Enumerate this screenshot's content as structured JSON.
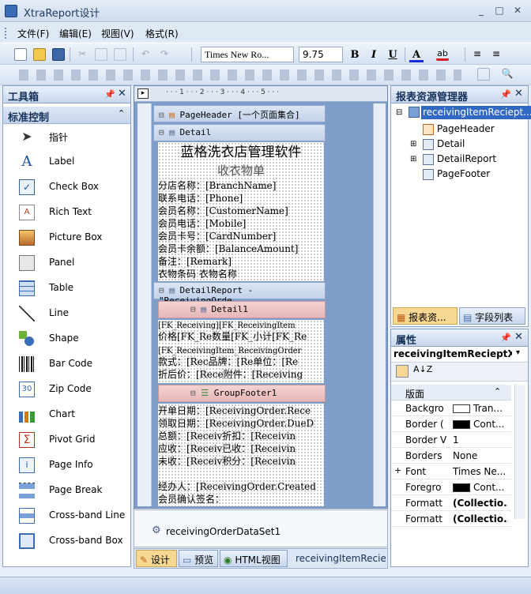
{
  "app": {
    "title": "XtraReport设计"
  },
  "menu": [
    "文件(F)",
    "编辑(E)",
    "视图(V)",
    "格式(R)"
  ],
  "toolbar": {
    "font_name": "Times New Ro...",
    "font_size": "9.75",
    "bold": "B",
    "italic": "I",
    "underline": "U",
    "font_color": "A"
  },
  "toolbox": {
    "title": "工具箱",
    "section": "标准控制",
    "items": [
      {
        "label": "指针",
        "icon": "pointer-icon"
      },
      {
        "label": "Label",
        "icon": "label-icon"
      },
      {
        "label": "Check Box",
        "icon": "checkbox-icon"
      },
      {
        "label": "Rich Text",
        "icon": "rich-text-icon"
      },
      {
        "label": "Picture Box",
        "icon": "picture-icon"
      },
      {
        "label": "Panel",
        "icon": "panel-icon"
      },
      {
        "label": "Table",
        "icon": "table-icon"
      },
      {
        "label": "Line",
        "icon": "line-icon"
      },
      {
        "label": "Shape",
        "icon": "shape-icon"
      },
      {
        "label": "Bar Code",
        "icon": "barcode-icon"
      },
      {
        "label": "Zip Code",
        "icon": "zipcode-icon"
      },
      {
        "label": "Chart",
        "icon": "chart-icon"
      },
      {
        "label": "Pivot Grid",
        "icon": "pivot-icon"
      },
      {
        "label": "Page Info",
        "icon": "page-info-icon"
      },
      {
        "label": "Page Break",
        "icon": "page-break-icon"
      },
      {
        "label": "Cross-band Line",
        "icon": "crossband-line-icon"
      },
      {
        "label": "Cross-band Box",
        "icon": "crossband-box-icon"
      }
    ]
  },
  "designer": {
    "ruler": "· · · 1 · · · 2 · · · 3 · · · 4 · · · 5 · · ·",
    "bands": {
      "page_header": "PageHeader [一个页面集合]",
      "detail": "Detail",
      "detail_report": "DetailReport - \"ReceivingOrde",
      "detail1": "Detail1",
      "group_footer": "GroupFooter1"
    },
    "detail_fields": [
      "蓝格洗衣店管理软件",
      "收衣物单",
      "分店名称：[BranchName]",
      "联系电话：[Phone]",
      "会员名称：[CustomerName]",
      "会员电话：[Mobile]",
      "会员卡号：[CardNumber]",
      "会员卡余额：[BalanceAmount]",
      "备注：[Remark]",
      "衣物条码      衣物名称"
    ],
    "detail1_fields": [
      "[FK_Receiving][FK_ReceivingItem",
      "价格[FK_Re数量[FK_小计[FK_Re",
      "[FK_ReceivingItem_ReceivingOrder",
      "款式：[Rec品牌：[Re单位：[Re",
      "折后价：[Rece附件：[Receiving"
    ],
    "footer_fields": [
      "开单日期：[ReceivingOrder.Rece",
      "领取日期：[ReceivingOrder.DueD",
      "总额：[Receiv折扣：[Receivin",
      "应收：[Receiv已收：[Receivin",
      "未收：[Receiv积分：[Receivin",
      "",
      "经办人：[ReceivingOrder.Created",
      "会员确认签名："
    ],
    "dataset": "receivingOrderDataSet1",
    "bottom_tabs": [
      "设计",
      "预览",
      "HTML视图"
    ],
    "report_name": "receivingItemRecie"
  },
  "explorer": {
    "title": "报表资源管理器",
    "root": "receivingItemReciept...",
    "children": [
      "PageHeader",
      "Detail",
      "DetailReport",
      "PageFooter"
    ],
    "tabs": [
      "报表资...",
      "字段列表"
    ]
  },
  "properties": {
    "title": "属性",
    "object": "receivingItemRecieptXt...",
    "category": "版面",
    "rows": [
      {
        "name": "Backgro",
        "value": "Tran...",
        "swatch": "#ffffff"
      },
      {
        "name": "Border (",
        "value": "Cont...",
        "swatch": "#000000"
      },
      {
        "name": "Border V",
        "value": "1",
        "swatch": ""
      },
      {
        "name": "Borders",
        "value": "None",
        "swatch": ""
      },
      {
        "name": "Font",
        "value": "Times Ne...",
        "swatch": "",
        "expander": "+"
      },
      {
        "name": "Foregro",
        "value": "Cont...",
        "swatch": "#000000"
      },
      {
        "name": "Formatt",
        "value": "(Collectio...",
        "swatch": "",
        "bold": true
      },
      {
        "name": "Formatt",
        "value": "(Collectio...",
        "swatch": "",
        "bold": true
      }
    ]
  }
}
